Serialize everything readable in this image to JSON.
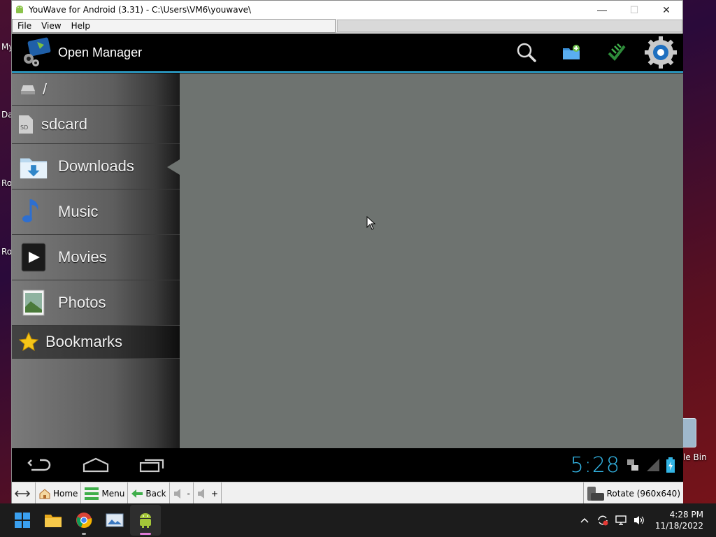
{
  "desktop": {
    "labels": [
      "My",
      "Da",
      "Ro",
      "Ro",
      "le Bin"
    ]
  },
  "window": {
    "title": "YouWave for Android (3.31) - C:\\Users\\VM6\\youwave\\",
    "minimize": "—",
    "maximize": "☐",
    "close": "✕"
  },
  "menubar": {
    "file": "File",
    "view": "View",
    "help": "Help"
  },
  "android": {
    "actionbar": {
      "title": "Open Manager",
      "actions": [
        "search-icon",
        "new-folder-icon",
        "app-icon",
        "settings-icon"
      ]
    },
    "drawer": {
      "root": "/",
      "sdcard": "sdcard",
      "sd_badge": "SD",
      "items": [
        {
          "label": "Downloads",
          "icon": "downloads-folder-icon",
          "selected": true
        },
        {
          "label": "Music",
          "icon": "music-note-icon",
          "selected": false
        },
        {
          "label": "Movies",
          "icon": "movies-play-icon",
          "selected": false
        },
        {
          "label": "Photos",
          "icon": "photos-icon",
          "selected": false
        }
      ],
      "bookmarks": "Bookmarks"
    },
    "navbar": {
      "clock": "5:28"
    }
  },
  "toolbar": {
    "home": "Home",
    "menu": "Menu",
    "back": "Back",
    "vol_down": "-",
    "vol_up": "+",
    "rotate": "Rotate (960x640)"
  },
  "taskbar": {
    "time": "4:28 PM",
    "date": "11/18/2022",
    "apps": [
      "windows-start-icon",
      "file-explorer-icon",
      "chrome-icon",
      "image-viewer-icon",
      "android-icon"
    ]
  },
  "colors": {
    "accent": "#33b5e5",
    "content_bg": "#6e7370",
    "taskbar_bg": "#1c1c1c"
  }
}
